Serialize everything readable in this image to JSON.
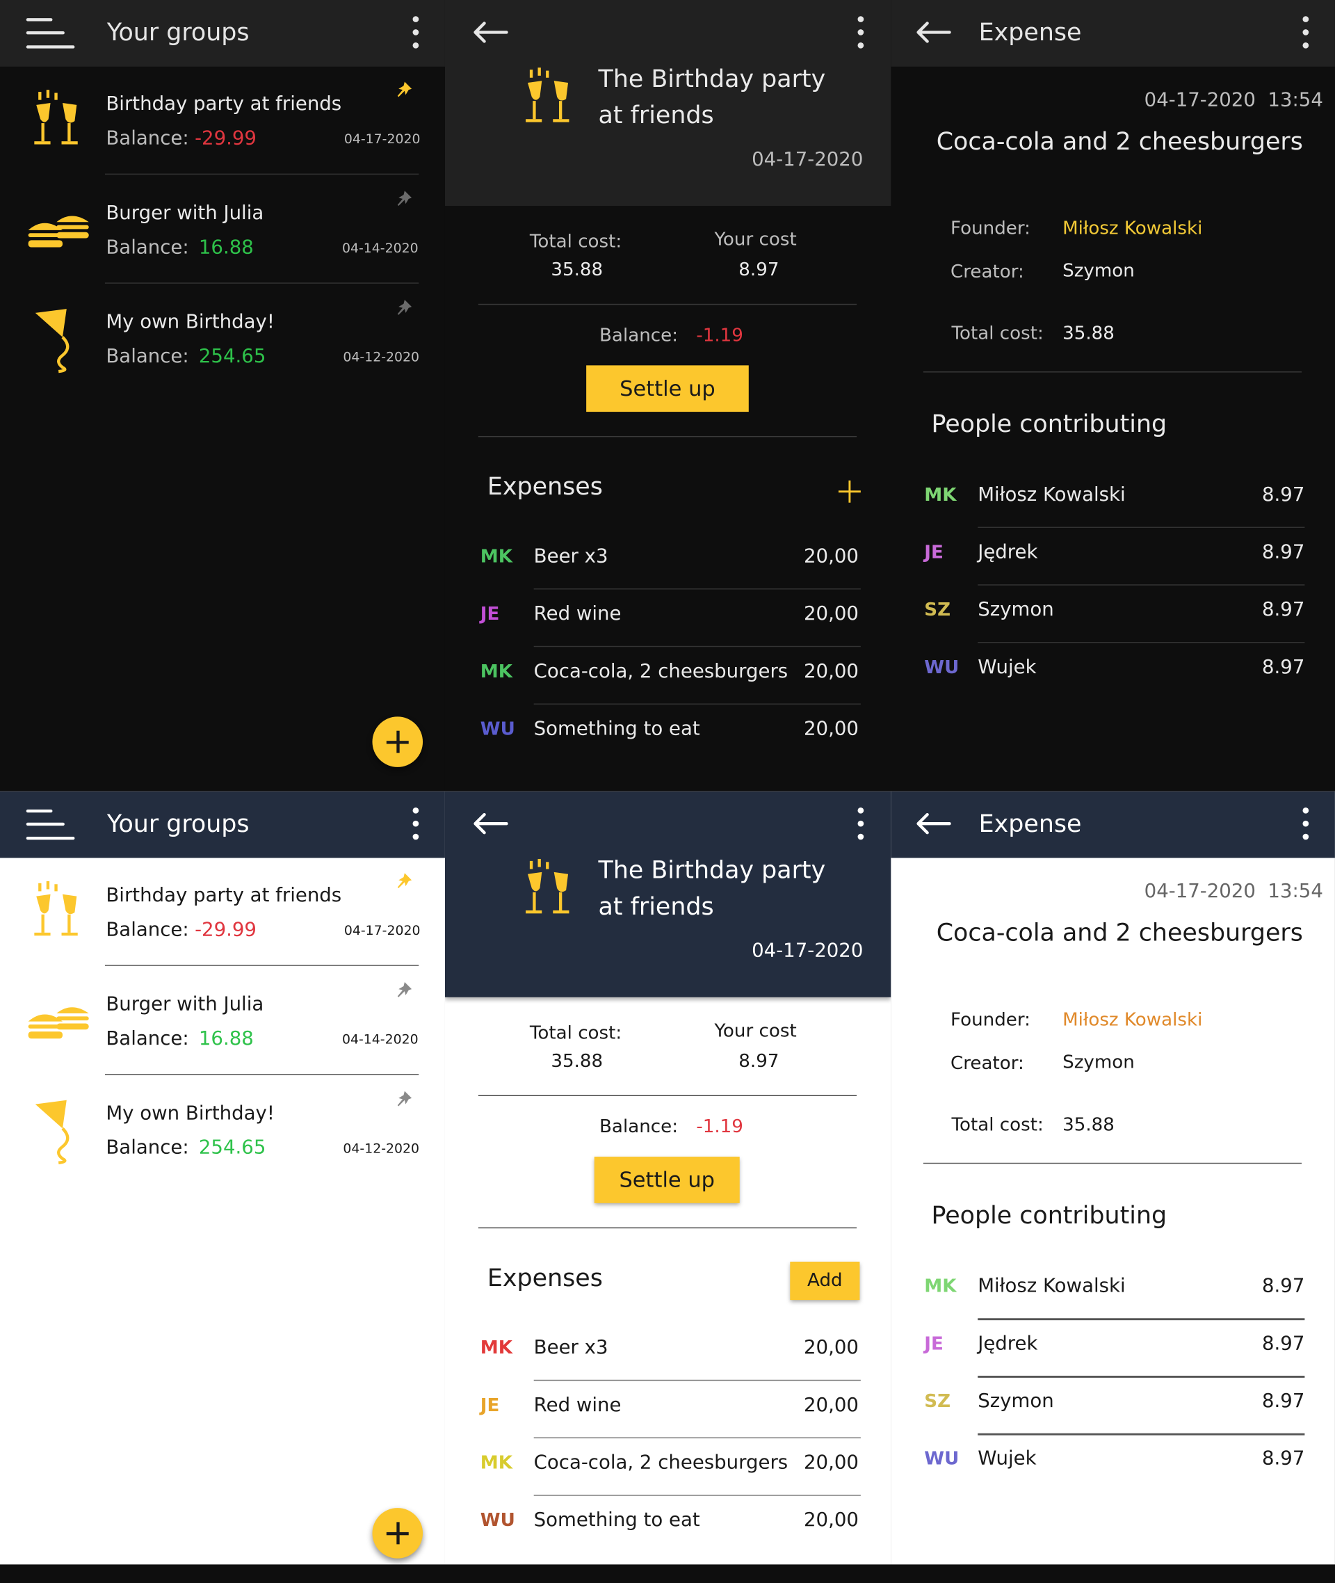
{
  "colors": {
    "accent": "#fcc72d",
    "dark_bg": "#0e0e0e",
    "dark_header": "#212121",
    "light_header": "#232d3f",
    "positive": "#2ec24a",
    "negative": "#e0363f",
    "founder_dark": "#f2c936",
    "founder_light": "#e0892a"
  },
  "groups_screen": {
    "title": "Your groups",
    "menu_icon": "hamburger-menu-icon",
    "more_icon": "more-vert-icon",
    "groups": [
      {
        "name": "Birthday party at friends",
        "balance_label": "Balance:",
        "balance": "-29.99",
        "date": "04-17-2020",
        "icon": "cheers-glasses-icon",
        "pinned": true
      },
      {
        "name": "Burger with Julia",
        "balance_label": "Balance:",
        "balance": "16.88",
        "date": "04-14-2020",
        "icon": "burgers-icon",
        "pinned": false
      },
      {
        "name": "My own Birthday!",
        "balance_label": "Balance:",
        "balance": "254.65",
        "date": "04-12-2020",
        "icon": "kite-icon",
        "pinned": false
      }
    ],
    "fab_icon": "plus-icon"
  },
  "group_screen": {
    "title_line1": "The Birthday party",
    "title_line2": "at friends",
    "date": "04-17-2020",
    "total_cost_label": "Total cost:",
    "total_cost": "35.88",
    "your_cost_label": "Your cost",
    "your_cost": "8.97",
    "balance_label": "Balance:",
    "balance": "-1.19",
    "settle_label": "Settle up",
    "expenses_heading": "Expenses",
    "add_label": "Add",
    "expenses": [
      {
        "initials": "MK",
        "name": "Beer x3",
        "amount": "20,00"
      },
      {
        "initials": "JE",
        "name": "Red wine",
        "amount": "20,00"
      },
      {
        "initials": "MK",
        "name": "Coca-cola, 2 cheesburgers",
        "amount": "20,00"
      },
      {
        "initials": "WU",
        "name": "Something to eat",
        "amount": "20,00"
      }
    ],
    "initials_colors_dark": [
      "#4cc461",
      "#c24fd6",
      "#4cc461",
      "#5a5ccf"
    ],
    "initials_colors_light": [
      "#e23a3a",
      "#e8a42a",
      "#d8cc2e",
      "#b1542f"
    ]
  },
  "expense_screen": {
    "title": "Expense",
    "datetime": "04-17-2020  13:54",
    "name": "Coca-cola and 2 cheesburgers",
    "founder_label": "Founder:",
    "founder": "Miłosz Kowalski",
    "creator_label": "Creator:",
    "creator": "Szymon",
    "total_label": "Total cost:",
    "total": "35.88",
    "people_heading": "People contributing",
    "people": [
      {
        "initials": "MK",
        "name": "Miłosz Kowalski",
        "amount": "8.97"
      },
      {
        "initials": "JE",
        "name": "Jędrek",
        "amount": "8.97"
      },
      {
        "initials": "SZ",
        "name": "Szymon",
        "amount": "8.97"
      },
      {
        "initials": "WU",
        "name": "Wujek",
        "amount": "8.97"
      }
    ],
    "initials_colors": [
      "#7ed673",
      "#c86ad8",
      "#d1bb52",
      "#6d68cf"
    ]
  }
}
